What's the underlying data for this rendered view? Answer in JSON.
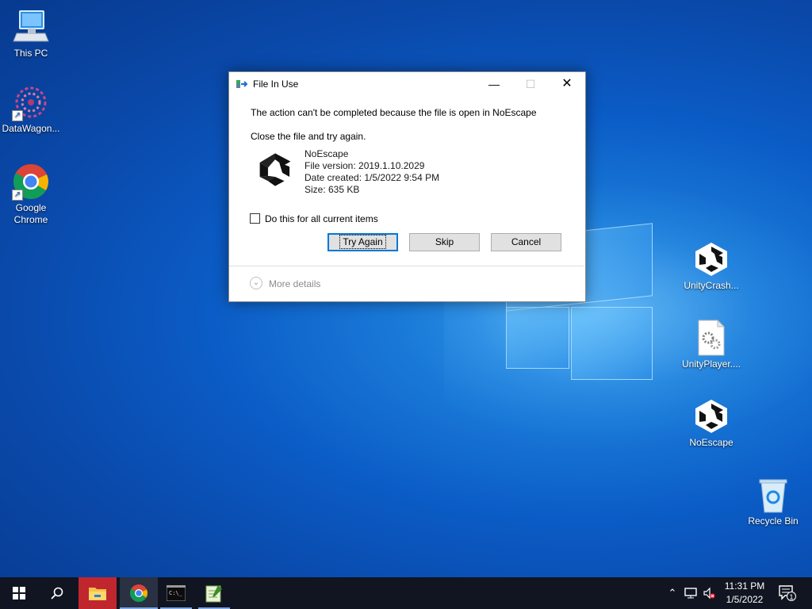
{
  "desktop": {
    "icons": [
      {
        "label": "This PC"
      },
      {
        "label": "DataWagon..."
      },
      {
        "label": "Google Chrome"
      },
      {
        "label": "UnityCrash..."
      },
      {
        "label": "UnityPlayer...."
      },
      {
        "label": "NoEscape"
      },
      {
        "label": "Recycle Bin"
      }
    ]
  },
  "dialog": {
    "title": "File In Use",
    "message": "The action can't be completed because the file is open in NoEscape",
    "instruction": "Close the file and try again.",
    "file": {
      "name": "NoEscape",
      "version": "File version: 2019.1.10.2029",
      "created": "Date created: 1/5/2022 9:54 PM",
      "size": "Size: 635 KB"
    },
    "checkbox_label": "Do this for all current items",
    "checkbox_checked": false,
    "buttons": {
      "try_again": "Try Again",
      "skip": "Skip",
      "cancel": "Cancel"
    },
    "more_details": "More details"
  },
  "taskbar": {
    "clock_time": "11:31 PM",
    "clock_date": "1/5/2022",
    "notification_count": "1"
  },
  "colors": {
    "accent": "#0078d7",
    "taskbar": "#101521",
    "explorer_active": "#c0262d"
  }
}
